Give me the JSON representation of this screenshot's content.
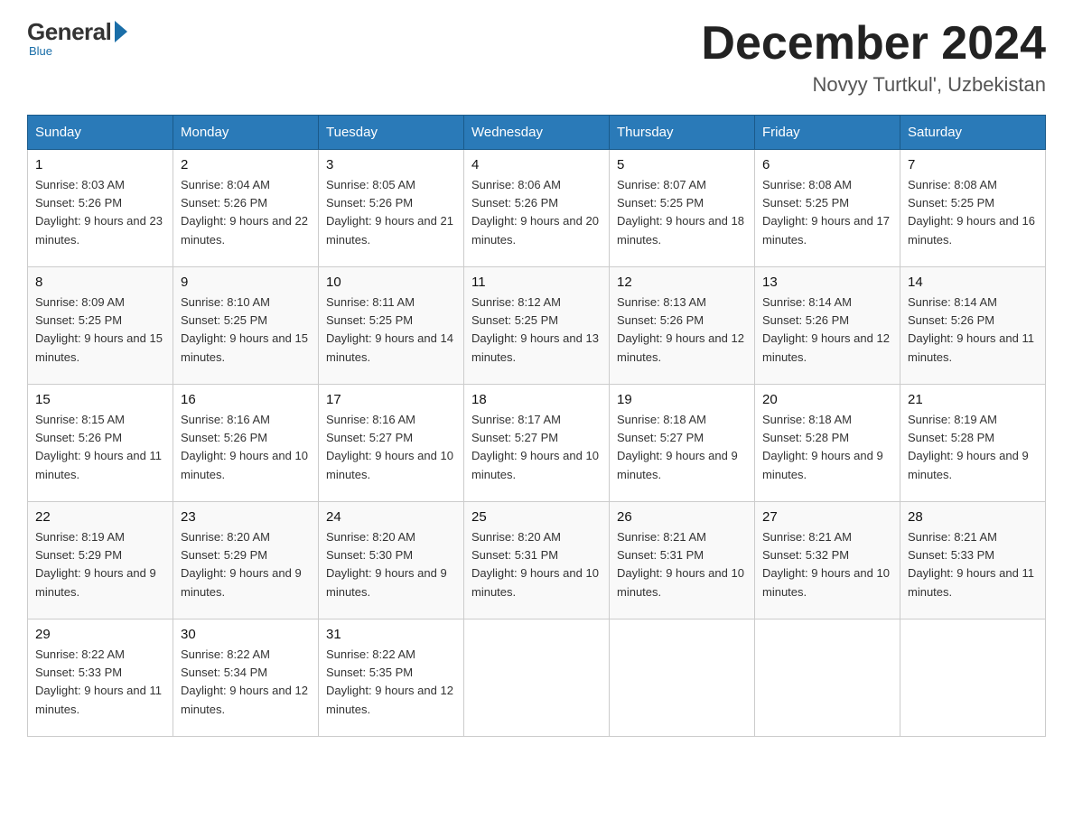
{
  "header": {
    "logo_general": "General",
    "logo_blue": "Blue",
    "logo_tagline": "Blue",
    "month_title": "December 2024",
    "subtitle": "Novyy Turtkul', Uzbekistan"
  },
  "days_of_week": [
    "Sunday",
    "Monday",
    "Tuesday",
    "Wednesday",
    "Thursday",
    "Friday",
    "Saturday"
  ],
  "weeks": [
    [
      {
        "day": "1",
        "sunrise": "8:03 AM",
        "sunset": "5:26 PM",
        "daylight": "9 hours and 23 minutes."
      },
      {
        "day": "2",
        "sunrise": "8:04 AM",
        "sunset": "5:26 PM",
        "daylight": "9 hours and 22 minutes."
      },
      {
        "day": "3",
        "sunrise": "8:05 AM",
        "sunset": "5:26 PM",
        "daylight": "9 hours and 21 minutes."
      },
      {
        "day": "4",
        "sunrise": "8:06 AM",
        "sunset": "5:26 PM",
        "daylight": "9 hours and 20 minutes."
      },
      {
        "day": "5",
        "sunrise": "8:07 AM",
        "sunset": "5:25 PM",
        "daylight": "9 hours and 18 minutes."
      },
      {
        "day": "6",
        "sunrise": "8:08 AM",
        "sunset": "5:25 PM",
        "daylight": "9 hours and 17 minutes."
      },
      {
        "day": "7",
        "sunrise": "8:08 AM",
        "sunset": "5:25 PM",
        "daylight": "9 hours and 16 minutes."
      }
    ],
    [
      {
        "day": "8",
        "sunrise": "8:09 AM",
        "sunset": "5:25 PM",
        "daylight": "9 hours and 15 minutes."
      },
      {
        "day": "9",
        "sunrise": "8:10 AM",
        "sunset": "5:25 PM",
        "daylight": "9 hours and 15 minutes."
      },
      {
        "day": "10",
        "sunrise": "8:11 AM",
        "sunset": "5:25 PM",
        "daylight": "9 hours and 14 minutes."
      },
      {
        "day": "11",
        "sunrise": "8:12 AM",
        "sunset": "5:25 PM",
        "daylight": "9 hours and 13 minutes."
      },
      {
        "day": "12",
        "sunrise": "8:13 AM",
        "sunset": "5:26 PM",
        "daylight": "9 hours and 12 minutes."
      },
      {
        "day": "13",
        "sunrise": "8:14 AM",
        "sunset": "5:26 PM",
        "daylight": "9 hours and 12 minutes."
      },
      {
        "day": "14",
        "sunrise": "8:14 AM",
        "sunset": "5:26 PM",
        "daylight": "9 hours and 11 minutes."
      }
    ],
    [
      {
        "day": "15",
        "sunrise": "8:15 AM",
        "sunset": "5:26 PM",
        "daylight": "9 hours and 11 minutes."
      },
      {
        "day": "16",
        "sunrise": "8:16 AM",
        "sunset": "5:26 PM",
        "daylight": "9 hours and 10 minutes."
      },
      {
        "day": "17",
        "sunrise": "8:16 AM",
        "sunset": "5:27 PM",
        "daylight": "9 hours and 10 minutes."
      },
      {
        "day": "18",
        "sunrise": "8:17 AM",
        "sunset": "5:27 PM",
        "daylight": "9 hours and 10 minutes."
      },
      {
        "day": "19",
        "sunrise": "8:18 AM",
        "sunset": "5:27 PM",
        "daylight": "9 hours and 9 minutes."
      },
      {
        "day": "20",
        "sunrise": "8:18 AM",
        "sunset": "5:28 PM",
        "daylight": "9 hours and 9 minutes."
      },
      {
        "day": "21",
        "sunrise": "8:19 AM",
        "sunset": "5:28 PM",
        "daylight": "9 hours and 9 minutes."
      }
    ],
    [
      {
        "day": "22",
        "sunrise": "8:19 AM",
        "sunset": "5:29 PM",
        "daylight": "9 hours and 9 minutes."
      },
      {
        "day": "23",
        "sunrise": "8:20 AM",
        "sunset": "5:29 PM",
        "daylight": "9 hours and 9 minutes."
      },
      {
        "day": "24",
        "sunrise": "8:20 AM",
        "sunset": "5:30 PM",
        "daylight": "9 hours and 9 minutes."
      },
      {
        "day": "25",
        "sunrise": "8:20 AM",
        "sunset": "5:31 PM",
        "daylight": "9 hours and 10 minutes."
      },
      {
        "day": "26",
        "sunrise": "8:21 AM",
        "sunset": "5:31 PM",
        "daylight": "9 hours and 10 minutes."
      },
      {
        "day": "27",
        "sunrise": "8:21 AM",
        "sunset": "5:32 PM",
        "daylight": "9 hours and 10 minutes."
      },
      {
        "day": "28",
        "sunrise": "8:21 AM",
        "sunset": "5:33 PM",
        "daylight": "9 hours and 11 minutes."
      }
    ],
    [
      {
        "day": "29",
        "sunrise": "8:22 AM",
        "sunset": "5:33 PM",
        "daylight": "9 hours and 11 minutes."
      },
      {
        "day": "30",
        "sunrise": "8:22 AM",
        "sunset": "5:34 PM",
        "daylight": "9 hours and 12 minutes."
      },
      {
        "day": "31",
        "sunrise": "8:22 AM",
        "sunset": "5:35 PM",
        "daylight": "9 hours and 12 minutes."
      },
      null,
      null,
      null,
      null
    ]
  ]
}
